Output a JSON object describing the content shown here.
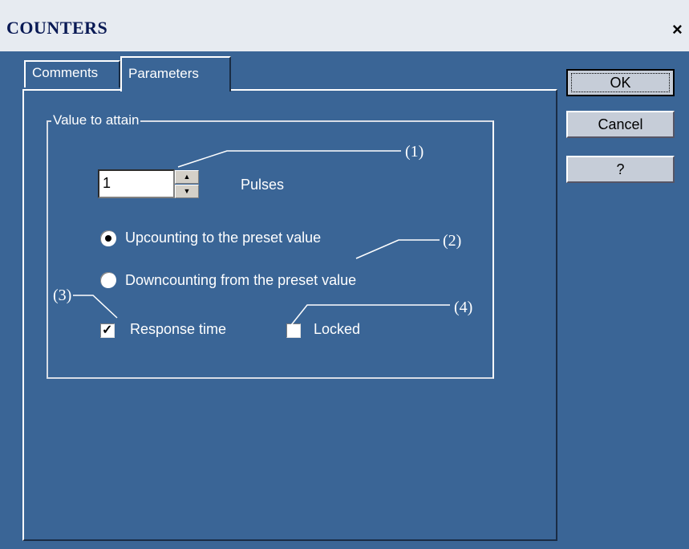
{
  "window": {
    "title": "COUNTERS",
    "close_label": "×"
  },
  "tabs": [
    {
      "label": "Comments",
      "active": false
    },
    {
      "label": "Parameters",
      "active": true
    }
  ],
  "group": {
    "legend": "Value to attain",
    "value": "1",
    "unit_label": "Pulses",
    "options": [
      {
        "label": "Upcounting to the preset value",
        "selected": true
      },
      {
        "label": "Downcounting from the preset value",
        "selected": false
      }
    ],
    "checkboxes": [
      {
        "label": "Response time",
        "checked": true
      },
      {
        "label": "Locked",
        "checked": false
      }
    ]
  },
  "buttons": {
    "ok": "OK",
    "cancel": "Cancel",
    "help": "?"
  },
  "callouts": [
    "(1)",
    "(2)",
    "(3)",
    "(4)"
  ],
  "colors": {
    "background": "#3a6596",
    "titlebar": "#e7ebf1",
    "title_text": "#0a1a55",
    "button_face": "#c6cdd8"
  },
  "icons": {
    "close": "close-icon",
    "spin_up": "spin-up-arrow-icon",
    "spin_down": "spin-down-arrow-icon"
  }
}
